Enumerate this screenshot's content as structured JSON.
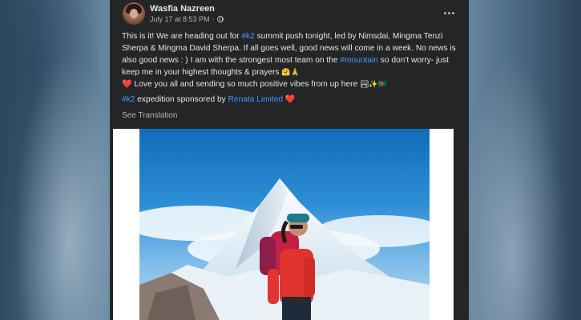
{
  "post": {
    "author": "Wasfia Nazreen",
    "timestamp": "July 17 at 8:53 PM",
    "privacy_separator": "·",
    "privacy_icon": "globe-icon",
    "more_icon": "more-options-icon",
    "text": {
      "p1_a": "This is it! We are heading out for ",
      "p1_tag1": "#k2",
      "p1_b": " summit push tonight, led by Nimsdai, Mingma Tenzi Sherpa & Mingma David Sherpa. If all goes well, good news will come in a week. No news is also good news : ) I am with the strongest most team on the ",
      "p1_tag2": "#mountain",
      "p1_c": " so don't worry- just keep me in your highest thoughts & prayers ",
      "p1_emoji1": "🤗🙏",
      "p1_heart": "❤️",
      "p1_d": " Love you all and sending so much positive vibes from up here ",
      "p1_emoji2": "🏞✨🇧🇩",
      "p2_tag": "#k2",
      "p2_a": " expedition sponsored by ",
      "p2_link": "Renata Limited",
      "p2_heart": "❤️"
    },
    "see_translation": "See Translation"
  },
  "colors": {
    "card_bg": "#242526",
    "text_primary": "#e4e6eb",
    "text_secondary": "#b0b3b8",
    "link_blue": "#4599ff",
    "heart_red": "#f02849"
  }
}
